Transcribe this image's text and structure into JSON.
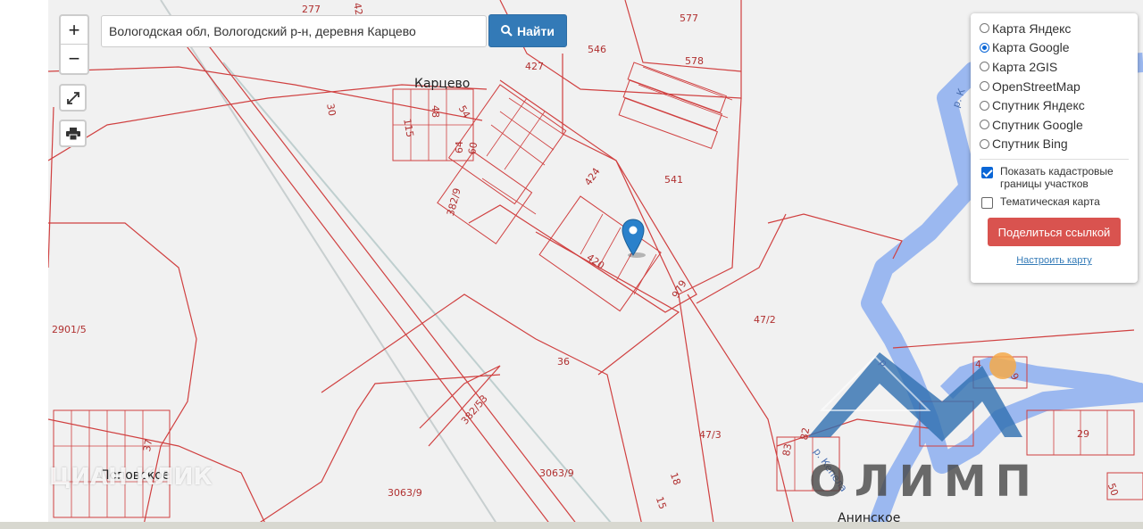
{
  "search": {
    "value": "Вологодская обл, Вологодский р-н, деревня Карцево",
    "button_label": "Найти"
  },
  "zoom": {
    "in_label": "+",
    "out_label": "−"
  },
  "layers": {
    "options": [
      {
        "label": "Карта Яндекс",
        "selected": false
      },
      {
        "label": "Карта Google",
        "selected": true
      },
      {
        "label": "Карта 2GIS",
        "selected": false
      },
      {
        "label": "OpenStreetMap",
        "selected": false
      },
      {
        "label": "Спутник Яндекс",
        "selected": false
      },
      {
        "label": "Спутник Google",
        "selected": false
      },
      {
        "label": "Спутник Bing",
        "selected": false
      }
    ],
    "cadastral_label": "Показать кадастровые границы участков",
    "cadastral_checked": true,
    "thematic_label": "Тематическая карта",
    "thematic_checked": false,
    "share_label": "Поделиться ссылкой",
    "configure_label": "Настроить карту"
  },
  "map": {
    "places": [
      "Карцево",
      "Поповское",
      "Анинское"
    ],
    "parcels": [
      "277",
      "42",
      "577",
      "546",
      "578",
      "427",
      "30",
      "48",
      "54",
      "115",
      "64",
      "60",
      "424",
      "541",
      "382/9",
      "420",
      "979",
      "2901/5",
      "47/2",
      "36",
      "382/53",
      "3063/9",
      "3063/9",
      "47/3",
      "18",
      "15",
      "4",
      "9",
      "29",
      "50",
      "82",
      "83",
      "37"
    ],
    "rivers": [
      "р. К",
      "р. Кепела",
      "р."
    ]
  },
  "watermarks": {
    "logo_text": "ОЛИМП",
    "cian_text": "ЦИАН КЛИК"
  },
  "colors": {
    "parcel": "#d04040",
    "river": "#9bb8f0",
    "button_blue": "#337ab7",
    "button_red": "#d9534f",
    "marker": "#2a81cb",
    "logo_blue": "#2f6fb0"
  }
}
